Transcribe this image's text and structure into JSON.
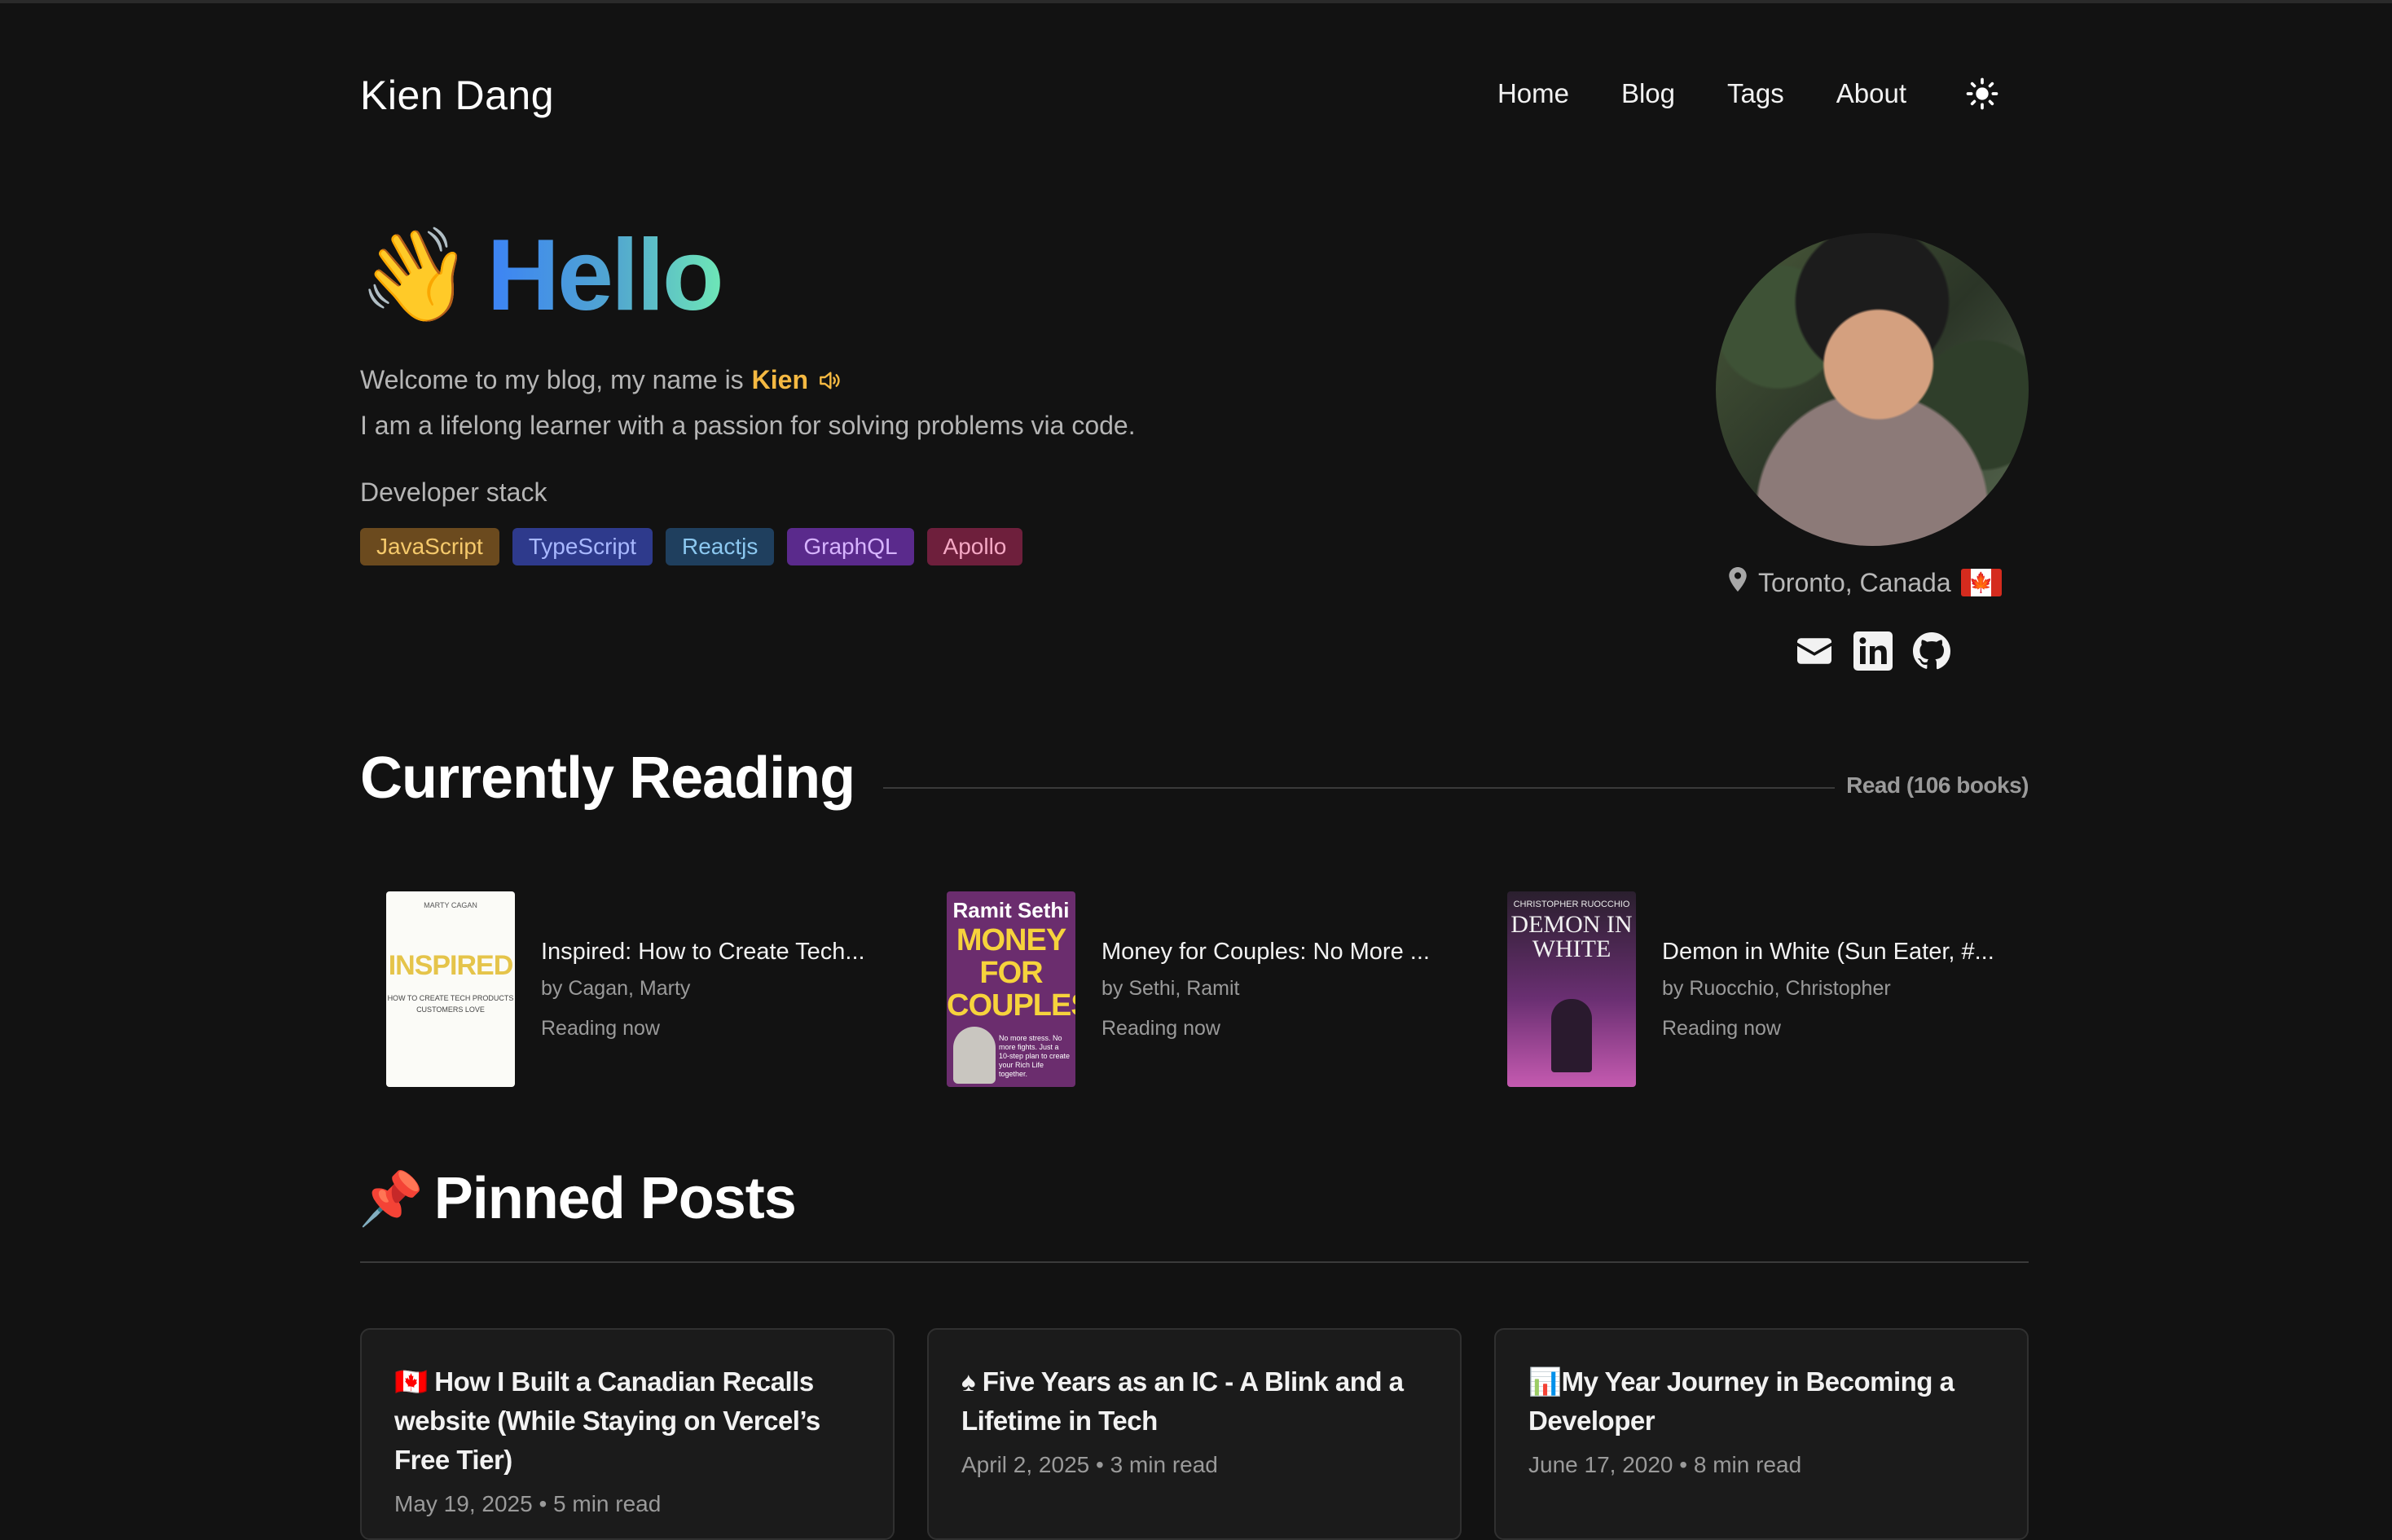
{
  "header": {
    "site_title": "Kien Dang",
    "nav": [
      "Home",
      "Blog",
      "Tags",
      "About"
    ],
    "theme_toggle_icon": "sun-icon"
  },
  "hero": {
    "wave_emoji": "👋",
    "greeting": "Hello",
    "welcome_prefix": "Welcome to my blog, my name is",
    "name": "Kien",
    "tagline": "I am a lifelong learner with a passion for solving problems via code.",
    "stack_label": "Developer stack",
    "stack": [
      {
        "label": "JavaScript",
        "bg": "#6b4a1e",
        "fg": "#f5c96b"
      },
      {
        "label": "TypeScript",
        "bg": "#2e3a8c",
        "fg": "#a8b8ff"
      },
      {
        "label": "Reactjs",
        "bg": "#1f3f5e",
        "fg": "#8cc8f0"
      },
      {
        "label": "GraphQL",
        "bg": "#5a2a8c",
        "fg": "#d7b4ff"
      },
      {
        "label": "Apollo",
        "bg": "#6e1f3c",
        "fg": "#f5a8c4"
      }
    ]
  },
  "profile": {
    "location": "Toronto, Canada",
    "flag_glyph": "🍁",
    "socials": [
      "mail-icon",
      "linkedin-icon",
      "github-icon"
    ]
  },
  "reading": {
    "title": "Currently Reading",
    "count_label": "Read (106 books)",
    "books": [
      {
        "title": "Inspired: How to Create Tech...",
        "author": "by Cagan, Marty",
        "status": "Reading now",
        "cover_author": "MARTY CAGAN",
        "cover_title": "INSPIRED",
        "cover_sub": "HOW TO CREATE TECH PRODUCTS CUSTOMERS LOVE"
      },
      {
        "title": "Money for Couples: No More ...",
        "author": "by Sethi, Ramit",
        "status": "Reading now",
        "cover_author": "Ramit Sethi",
        "cover_title": "MONEY FOR COUPLES",
        "cover_sub": "No more stress. No more fights. Just a 10-step plan to create your Rich Life together."
      },
      {
        "title": "Demon in White (Sun Eater, #...",
        "author": "by Ruocchio, Christopher",
        "status": "Reading now",
        "cover_author": "CHRISTOPHER RUOCCHIO",
        "cover_title": "DEMON IN WHITE"
      }
    ]
  },
  "pinned": {
    "pin_emoji": "📌",
    "title": "Pinned Posts",
    "posts": [
      {
        "title": "🇨🇦 How I Built a Canadian Recalls website (While Staying on Vercel’s Free Tier)",
        "meta": "May 19, 2025 • 5 min read"
      },
      {
        "title": "♠ Five Years as an IC - A Blink and a Lifetime in Tech",
        "meta": "April 2, 2025 • 3 min read"
      },
      {
        "title": "📊My Year Journey in Becoming a Developer",
        "meta": "June 17, 2020 • 8 min read"
      }
    ]
  }
}
